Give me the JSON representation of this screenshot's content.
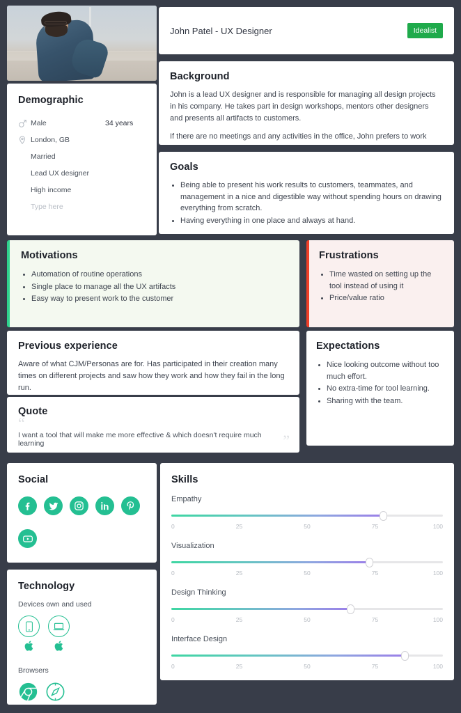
{
  "persona": {
    "name": "John Patel - UX Designer",
    "type_badge": "Idealist",
    "badge_color": "#1faa4b",
    "photo_alt": "bearded man with glasses in denim shirt outdoors"
  },
  "demographic": {
    "title": "Demographic",
    "rows": [
      {
        "icon": "male-gender-icon",
        "label": "Male"
      },
      {
        "icon": "location-pin-icon",
        "label": "London, GB"
      },
      {
        "icon": "",
        "label": "Married"
      },
      {
        "icon": "",
        "label": "Lead UX designer"
      },
      {
        "icon": "",
        "label": "High income"
      },
      {
        "icon": "",
        "label": "Type here",
        "muted": true
      }
    ],
    "age": "34 years"
  },
  "background": {
    "title": "Background",
    "paragraphs": [
      "John is a lead UX designer and is responsible for managing all design projects in his company. He takes part in design workshops, mentors other designers and presents all artifacts to customers.",
      "If there are no meetings and any activities in the office, John prefers to work remotely - it allows him to spend more time with his family and help his wife."
    ]
  },
  "goals": {
    "title": "Goals",
    "items": [
      "Being able to present his work results to customers, teammates, and management in a nice and digestible way without spending hours on drawing everything from scratch.",
      "Having everything in one place and always at hand."
    ]
  },
  "motivations": {
    "title": "Motivations",
    "accent_color": "#2fd18d",
    "background_color": "#f4f9f0",
    "items": [
      "Automation of routine operations",
      "Single place to manage all the UX artifacts",
      "Easy way to present work to the customer"
    ]
  },
  "frustrations": {
    "title": "Frustrations",
    "accent_color": "#ef3f28",
    "background_color": "#faf0ef",
    "items": [
      "Time wasted on setting up the tool instead of using it",
      "Price/value ratio"
    ]
  },
  "previous_experience": {
    "title": "Previous experience",
    "text": "Aware of what CJM/Personas are for. Has participated in their creation many times on different projects and saw how they work and how they fail in the long run."
  },
  "quote": {
    "title": "Quote",
    "open_mark": "“",
    "close_mark": "”",
    "text": "I want a tool that will make me more effective & which doesn't require much learning"
  },
  "expectations": {
    "title": "Expectations",
    "items": [
      "Nice looking outcome without too much effort.",
      "No extra-time for tool learning.",
      "Sharing with the team."
    ]
  },
  "social": {
    "title": "Social",
    "icon_color": "#24bf92",
    "networks": [
      {
        "icon": "facebook-icon",
        "name": "Facebook"
      },
      {
        "icon": "twitter-icon",
        "name": "Twitter"
      },
      {
        "icon": "instagram-icon",
        "name": "Instagram"
      },
      {
        "icon": "linkedin-icon",
        "name": "LinkedIn"
      },
      {
        "icon": "pinterest-icon",
        "name": "Pinterest"
      },
      {
        "icon": "youtube-icon",
        "name": "YouTube"
      }
    ]
  },
  "technology": {
    "title": "Technology",
    "devices_label": "Devices own and used",
    "devices": [
      {
        "icon": "smartphone-icon",
        "name": "Smartphone",
        "os_icon": "apple-logo-icon"
      },
      {
        "icon": "laptop-icon",
        "name": "Laptop",
        "os_icon": "apple-logo-icon"
      }
    ],
    "browsers_label": "Browsers",
    "browsers": [
      {
        "icon": "chrome-icon",
        "name": "Chrome"
      },
      {
        "icon": "safari-icon",
        "name": "Safari"
      }
    ]
  },
  "skills": {
    "title": "Skills",
    "scale_ticks": [
      "0",
      "25",
      "50",
      "75",
      "100"
    ],
    "items": [
      {
        "name": "Empathy",
        "value": 78
      },
      {
        "name": "Visualization",
        "value": 73
      },
      {
        "name": "Design Thinking",
        "value": 66
      },
      {
        "name": "Interface Design",
        "value": 86
      }
    ]
  },
  "chart_data": {
    "type": "bar",
    "title": "Skills",
    "categories": [
      "Empathy",
      "Visualization",
      "Design Thinking",
      "Interface Design"
    ],
    "values": [
      78,
      73,
      66,
      86
    ],
    "xlabel": "",
    "ylabel": "",
    "ylim": [
      0,
      100
    ],
    "tick_labels": [
      "0",
      "25",
      "50",
      "75",
      "100"
    ],
    "grid": false,
    "legend": "none"
  }
}
